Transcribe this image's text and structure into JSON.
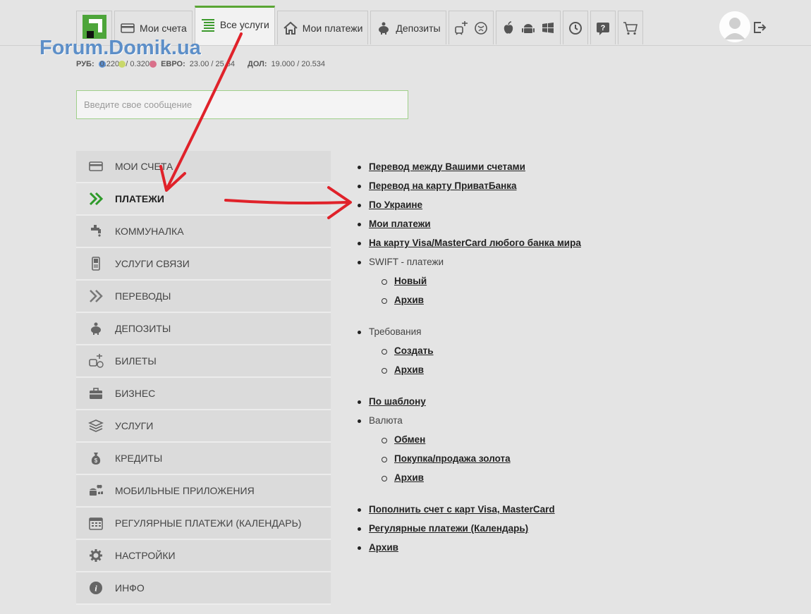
{
  "nav": {
    "tabs": [
      {
        "id": "logo",
        "icon": "privat-logo-icon"
      },
      {
        "id": "accounts",
        "label": "Мои счета",
        "icon": "card-icon"
      },
      {
        "id": "services",
        "label": "Все услуги",
        "icon": "list-icon",
        "active": true
      },
      {
        "id": "payments",
        "label": "Мои платежи",
        "icon": "house-icon"
      },
      {
        "id": "deposits",
        "label": "Депозиты",
        "icon": "piggy-bank-icon"
      },
      {
        "id": "tickets",
        "icon": "train-plane-icon"
      },
      {
        "id": "apps",
        "icon": "mobile-platforms-icon"
      },
      {
        "id": "history",
        "icon": "history-icon"
      },
      {
        "id": "help",
        "icon": "help-icon"
      },
      {
        "id": "cart",
        "icon": "cart-icon"
      }
    ],
    "accent": "#5aa634"
  },
  "watermark": "Forum.Domik.ua",
  "rates": {
    "rub_label": "РУБ:",
    "rub_value": "0.2200 / 0.3200",
    "eur_label": "ЕВРО:",
    "eur_value": "23.00 / 25.64",
    "usd_label": "ДОЛ:",
    "usd_value": "19.000 / 20.534",
    "dots": [
      "#5b8fd1",
      "#c9d86a",
      "#d9708a"
    ]
  },
  "message": {
    "placeholder": "Введите свое сообщение"
  },
  "sidebar": {
    "items": [
      {
        "label": "МОИ СЧЕТА",
        "icon": "card-icon"
      },
      {
        "label": "ПЛАТЕЖИ",
        "icon": "double-chevron-icon",
        "active": true
      },
      {
        "label": "КОММУНАЛКА",
        "icon": "faucet-icon"
      },
      {
        "label": "УСЛУГИ СВЯЗИ",
        "icon": "phone-icon"
      },
      {
        "label": "ПЕРЕВОДЫ",
        "icon": "transfer-icon"
      },
      {
        "label": "ДЕПОЗИТЫ",
        "icon": "piggy-bank-icon"
      },
      {
        "label": "БИЛЕТЫ",
        "icon": "tickets-icon"
      },
      {
        "label": "БИЗНЕС",
        "icon": "briefcase-icon"
      },
      {
        "label": "УСЛУГИ",
        "icon": "box-icon"
      },
      {
        "label": "КРЕДИТЫ",
        "icon": "money-bag-icon"
      },
      {
        "label": "МОБИЛЬНЫЕ ПРИЛОЖЕНИЯ",
        "icon": "mobile-platforms-icon"
      },
      {
        "label": "РЕГУЛЯРНЫЕ ПЛАТЕЖИ (КАЛЕНДАРЬ)",
        "icon": "calendar-icon"
      },
      {
        "label": "НАСТРОЙКИ",
        "icon": "gear-icon"
      },
      {
        "label": "ИНФО",
        "icon": "info-icon"
      }
    ]
  },
  "content": {
    "links": [
      {
        "label": "Перевод между Вашими счетами",
        "link": true
      },
      {
        "label": "Перевод на карту ПриватБанка",
        "link": true
      },
      {
        "label": "По Украине",
        "link": true
      },
      {
        "label": "Мои платежи",
        "link": true
      },
      {
        "label": "На карту Visa/MasterCard любого банка мира",
        "link": true
      },
      {
        "label": "SWIFT - платежи",
        "link": false
      },
      {
        "label": "Новый",
        "link": true,
        "sub": true
      },
      {
        "label": "Архив",
        "link": true,
        "sub": true
      },
      {
        "gap": true
      },
      {
        "label": "Требования",
        "link": false
      },
      {
        "label": "Создать",
        "link": true,
        "sub": true
      },
      {
        "label": "Архив",
        "link": true,
        "sub": true
      },
      {
        "gap": true
      },
      {
        "label": "По шаблону",
        "link": true
      },
      {
        "label": "Валюта",
        "link": false
      },
      {
        "label": "Обмен",
        "link": true,
        "sub": true
      },
      {
        "label": "Покупка/продажа золота",
        "link": true,
        "sub": true
      },
      {
        "label": "Архив",
        "link": true,
        "sub": true
      },
      {
        "gap": true
      },
      {
        "label": "Пополнить счет с карт Visa, MasterCard",
        "link": true
      },
      {
        "label": "Регулярные платежи (Календарь)",
        "link": true
      },
      {
        "label": "Архив",
        "link": true
      }
    ]
  },
  "annotation_color": "#e0222a"
}
